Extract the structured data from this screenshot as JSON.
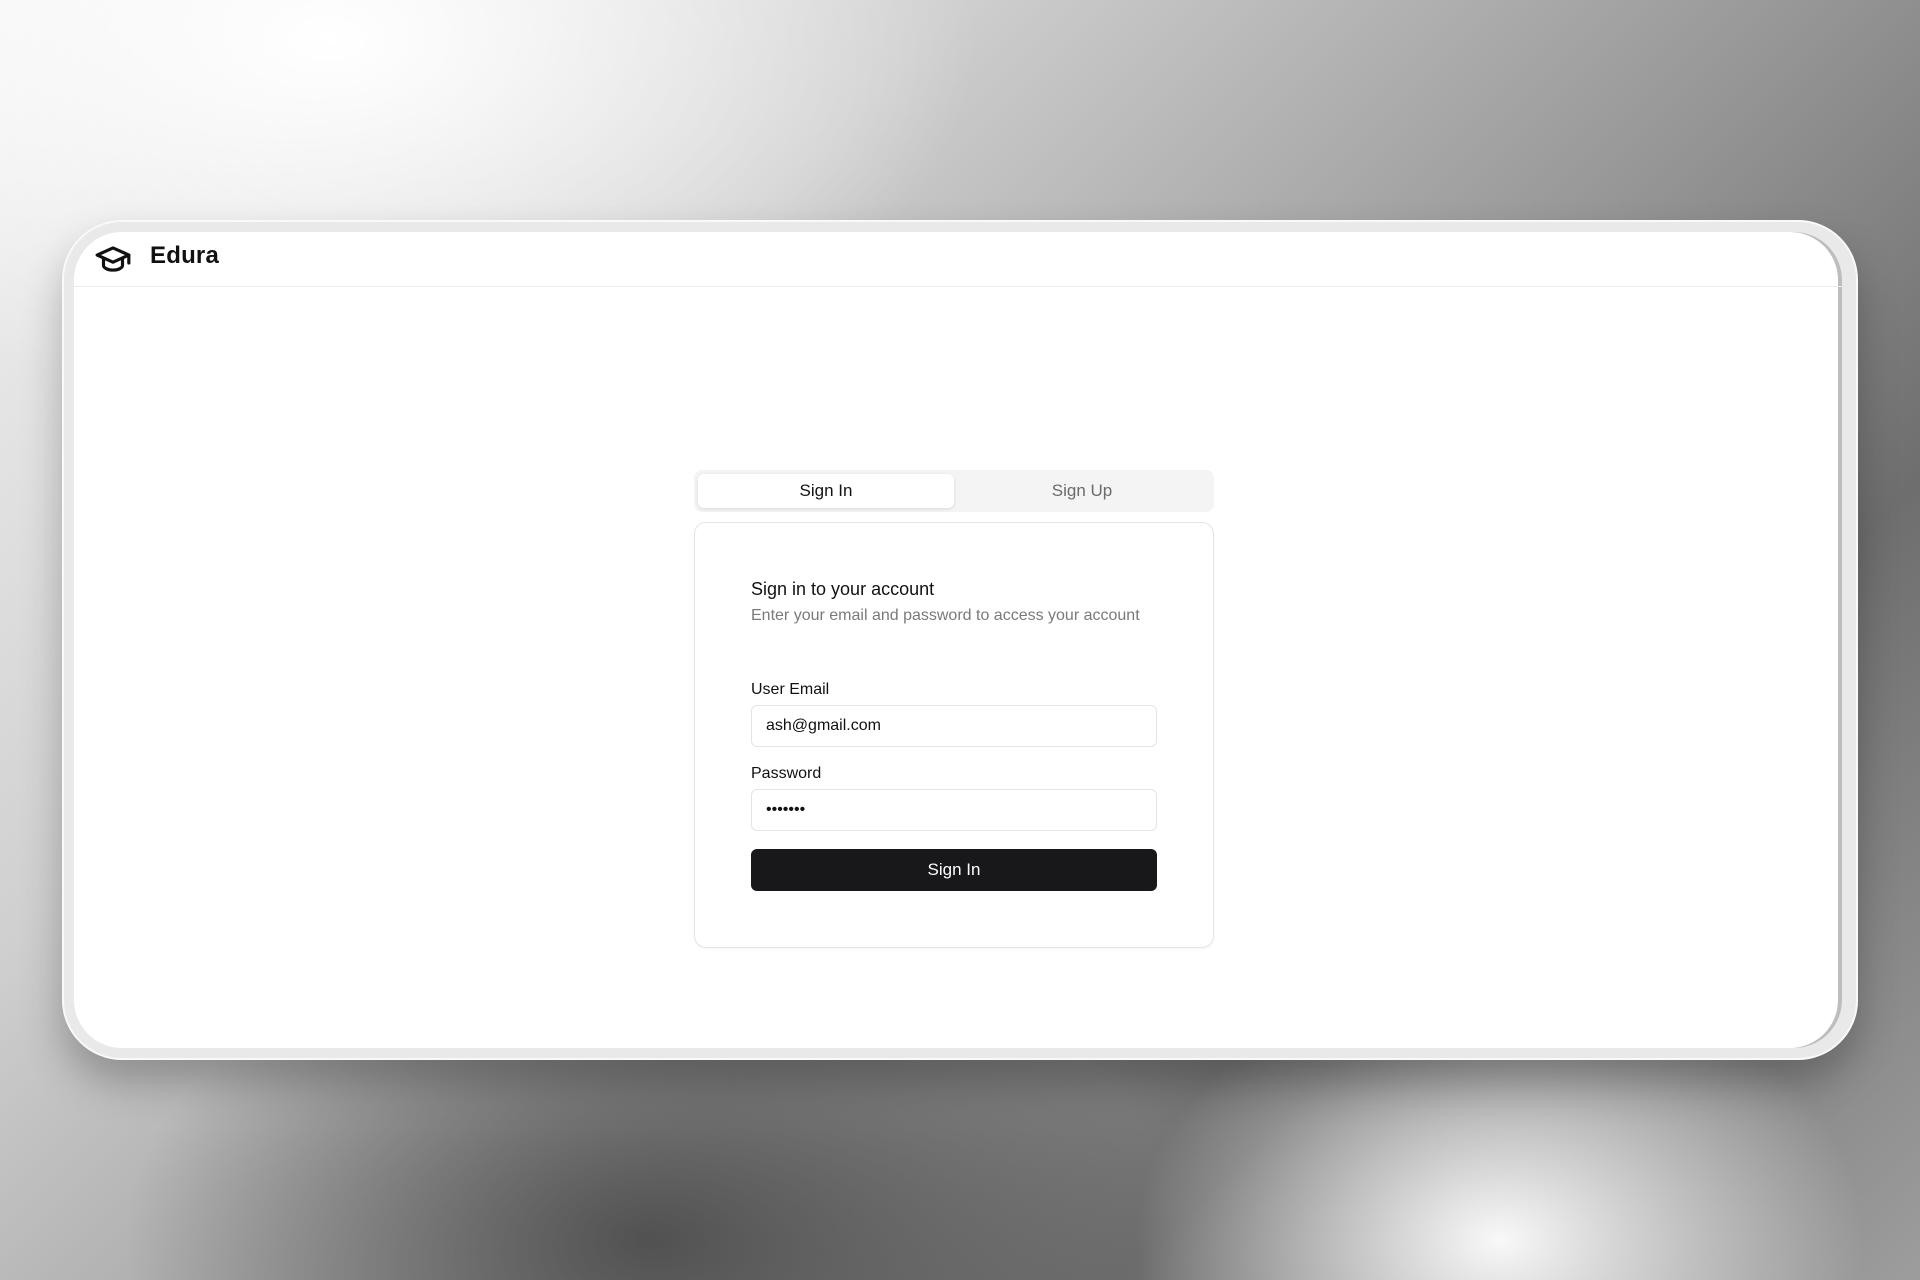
{
  "app": {
    "name": "Edura",
    "logo_icon": "graduation-cap-icon"
  },
  "auth_tabs": [
    {
      "label": "Sign In",
      "active": true
    },
    {
      "label": "Sign Up",
      "active": false
    }
  ],
  "card": {
    "title": "Sign in to your account",
    "subtitle": "Enter your email and password to access your account",
    "email_label": "User Email",
    "email_value": "ash@gmail.com",
    "password_label": "Password",
    "password_value": "•••••••",
    "submit_label": "Sign In"
  },
  "colors": {
    "primary_button": "#18181b",
    "page_background": "#ffffff",
    "muted_text": "#7a7a7a"
  }
}
